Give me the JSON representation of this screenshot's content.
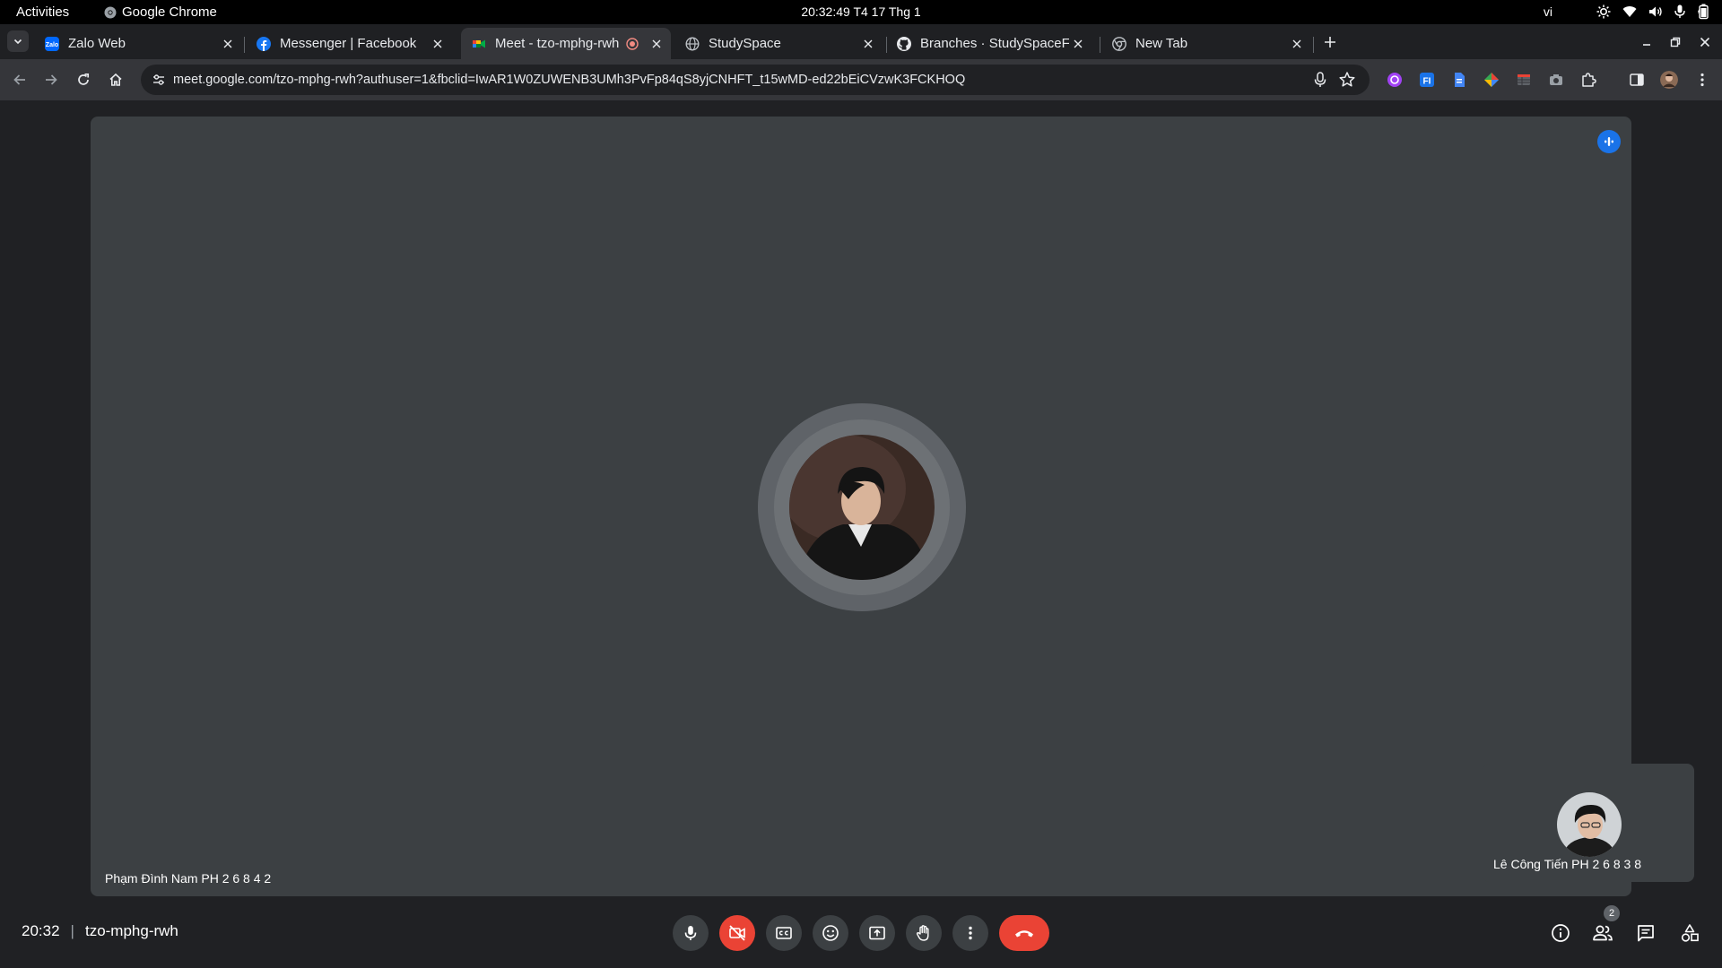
{
  "topbar": {
    "activities": "Activities",
    "app_name": "Google Chrome",
    "clock": "20:32:49  T4 17 Thg 1",
    "language": "vi"
  },
  "tabs": [
    {
      "title": "Zalo Web",
      "icon": "zalo-icon"
    },
    {
      "title": "Messenger | Facebook",
      "icon": "facebook-icon"
    },
    {
      "title": "Meet - tzo-mphg-rwh",
      "icon": "meet-icon",
      "active": true,
      "recording": true
    },
    {
      "title": "StudySpace",
      "icon": "globe-icon"
    },
    {
      "title": "Branches · StudySpaceFl",
      "icon": "github-icon"
    },
    {
      "title": "New Tab",
      "icon": "chrome-icon"
    }
  ],
  "omnibox": {
    "host": "meet.google.com",
    "path": "/tzo-mphg-rwh?authuser=1&fbclid=IwAR1W0ZUWENB3UMh3PvFp84qS8yjCNHFT_t15wMD-ed22bEiCVzwK3FCKHOQ"
  },
  "meeting": {
    "main_participant": "Phạm Đình Nam PH 2 6 8 4 2",
    "self_participant": "Lê Công Tiến PH 2 6 8 3 8",
    "time": "20:32",
    "code": "tzo-mphg-rwh",
    "participant_count": "2"
  },
  "colors": {
    "tile": "#3c4043",
    "background": "#202124",
    "end_call": "#ea4335",
    "speaking": "#1a73e8"
  }
}
